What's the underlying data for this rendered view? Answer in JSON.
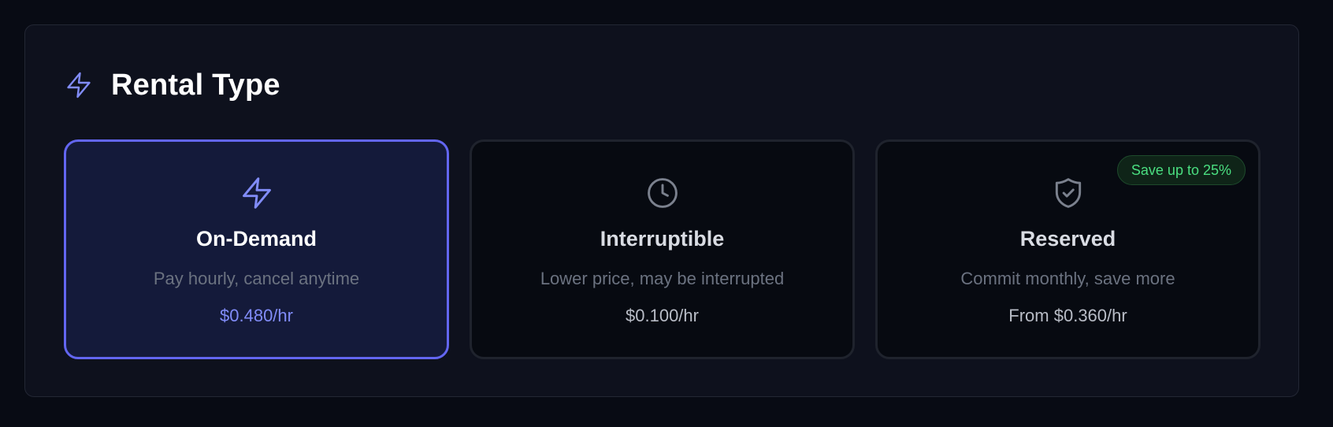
{
  "section": {
    "title": "Rental Type",
    "icon": "lightning-icon",
    "accent_color": "#6366f1"
  },
  "options": [
    {
      "id": "on-demand",
      "icon": "lightning-icon",
      "title": "On-Demand",
      "description": "Pay hourly, cancel anytime",
      "price": "$0.480/hr",
      "selected": true
    },
    {
      "id": "interruptible",
      "icon": "clock-icon",
      "title": "Interruptible",
      "description": "Lower price, may be interrupted",
      "price": "$0.100/hr",
      "selected": false
    },
    {
      "id": "reserved",
      "icon": "shield-check-icon",
      "title": "Reserved",
      "description": "Commit monthly, save more",
      "price": "From $0.360/hr",
      "selected": false,
      "badge": "Save up to 25%",
      "badge_color": "#4ade80"
    }
  ]
}
